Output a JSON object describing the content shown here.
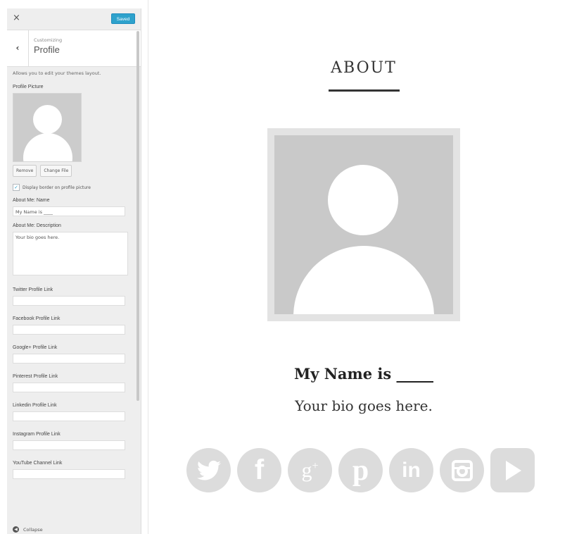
{
  "customizer": {
    "close_glyph": "×",
    "saved_label": "Saved",
    "back_glyph": "‹",
    "breadcrumb": "Customizing",
    "section_title": "Profile",
    "description": "Allows you to edit your themes layout.",
    "profile_picture_label": "Profile Picture",
    "remove_label": "Remove",
    "change_file_label": "Change File",
    "border_checkbox_label": "Display border on profile picture",
    "border_checked": true,
    "name_label": "About Me: Name",
    "name_value": "My Name is ____",
    "description_label": "About Me: Description",
    "description_value": "Your bio goes here.",
    "links": [
      {
        "label": "Twitter Profile Link",
        "value": ""
      },
      {
        "label": "Facebook Profile Link",
        "value": ""
      },
      {
        "label": "Google+ Profile Link",
        "value": ""
      },
      {
        "label": "Pinterest Profile Link",
        "value": ""
      },
      {
        "label": "Linkedin Profile Link",
        "value": ""
      },
      {
        "label": "Instagram Profile Link",
        "value": ""
      },
      {
        "label": "YouTube Channel Link",
        "value": ""
      }
    ],
    "collapse_label": "Collapse"
  },
  "preview": {
    "heading": "ABOUT",
    "name": "My Name is _____",
    "bio": "Your bio goes here.",
    "social_icons": [
      {
        "name": "twitter-icon",
        "glyph": "🐦"
      },
      {
        "name": "facebook-icon",
        "glyph": "f"
      },
      {
        "name": "google-plus-icon",
        "glyph": "g+"
      },
      {
        "name": "pinterest-icon",
        "glyph": "p"
      },
      {
        "name": "linkedin-icon",
        "glyph": "in"
      },
      {
        "name": "instagram-icon",
        "glyph": "◙"
      },
      {
        "name": "youtube-icon",
        "glyph": "▶"
      }
    ]
  },
  "colors": {
    "accent": "#2ea2cc",
    "social_gray": "#dcdcdc",
    "avatar_gray": "#c9c9c9"
  }
}
